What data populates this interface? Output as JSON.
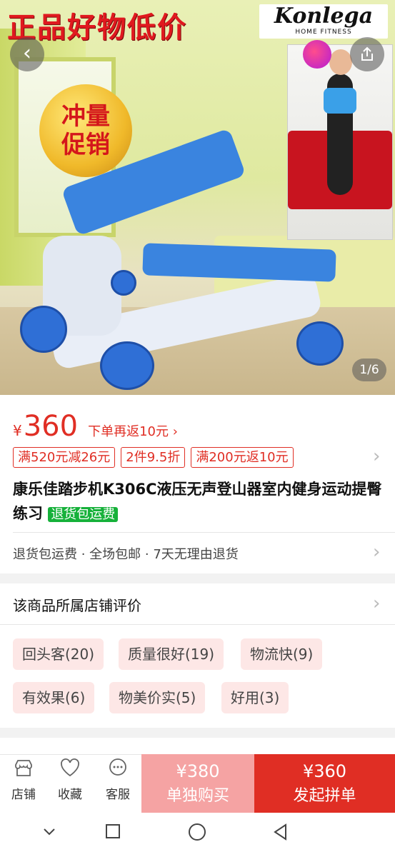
{
  "hero": {
    "banner_text": "正品好物低价",
    "brand_name": "Konlega",
    "brand_sub": "HOME FITNESS",
    "promo_line1": "冲量",
    "promo_line2": "促销",
    "image_counter": "1/6"
  },
  "product": {
    "currency": "¥",
    "price": "360",
    "rebate": "下单再返10元",
    "promo_tags": [
      "满520元减26元",
      "2件9.5折",
      "满200元返10元"
    ],
    "title": "康乐佳踏步机K306C液压无声登山器室内健身运动提臀练习",
    "title_badge": "退货包运费",
    "service": "退货包运费 · 全场包邮 · 7天无理由退货"
  },
  "reviews": {
    "title": "该商品所属店铺评价",
    "chips": [
      "回头客(20)",
      "质量很好(19)",
      "物流快(9)",
      "有效果(6)",
      "物美价实(5)",
      "好用(3)"
    ]
  },
  "bottom": {
    "store_label": "店铺",
    "favorite_label": "收藏",
    "service_label": "客服",
    "alone_price": "¥380",
    "alone_label": "单独购买",
    "group_price": "¥360",
    "group_label": "发起拼单"
  },
  "colors": {
    "accent": "#e02e24",
    "green_badge": "#16b13a",
    "alone_bg": "#f5a3a3"
  }
}
